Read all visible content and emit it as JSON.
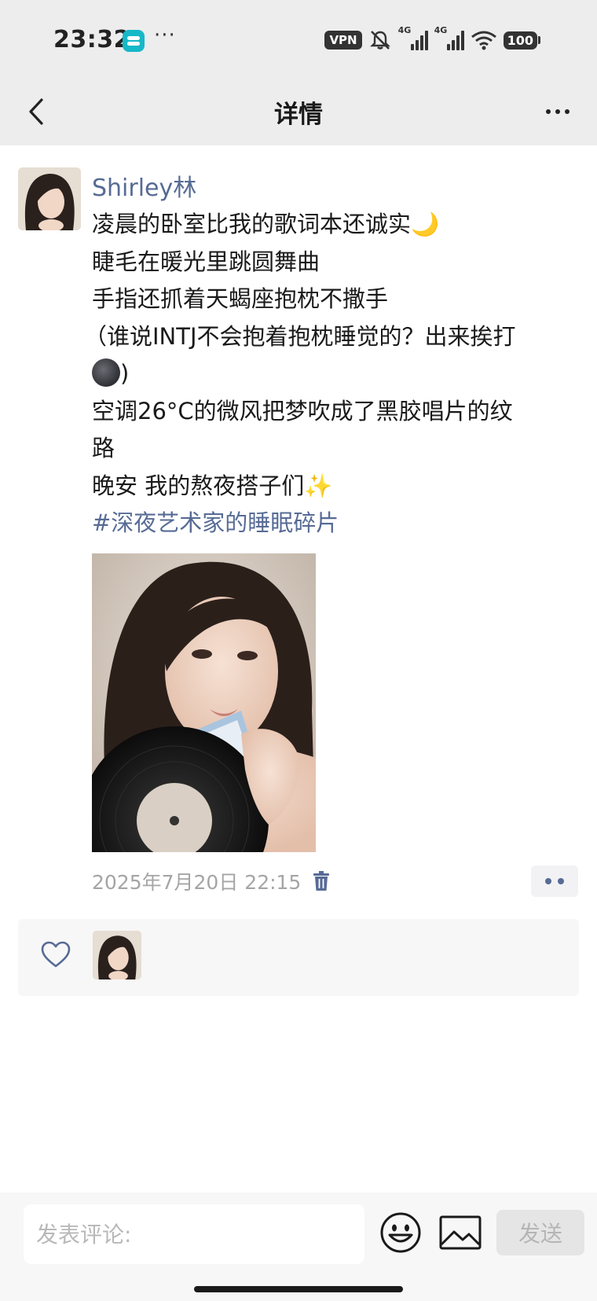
{
  "status_bar": {
    "time": "23:32",
    "dots": "···",
    "vpn": "VPN",
    "network_1": "4G",
    "network_2": "4G",
    "battery": "100"
  },
  "nav": {
    "title": "详情",
    "back_icon": "chevron-left-icon",
    "more_icon": "more-horizontal-icon"
  },
  "post": {
    "author": "Shirley林",
    "lines": [
      "凌晨的卧室比我的歌词本还诚实",
      "睫毛在暖光里跳圆舞曲",
      "手指还抓着天蝎座抱枕不撒手",
      "（谁说INTJ不会抱着抱枕睡觉的？出来挨打",
      ")",
      "空调26°C的微风把梦吹成了黑胶唱片的纹",
      "路",
      "晚安 我的熬夜搭子们",
      "#深夜艺术家的睡眠碎片"
    ],
    "emoji": {
      "moon": "🌙",
      "sparkles": "✨"
    },
    "photo": "portrait-with-vinyl-record",
    "timestamp": "2025年7月20日 22:15",
    "delete_icon": "trash-icon",
    "action_icon": "two-dots-icon"
  },
  "likes": {
    "heart_icon": "heart-outline-icon"
  },
  "comment_bar": {
    "placeholder": "发表评论:",
    "emoji_icon": "smiley-icon",
    "image_icon": "image-icon",
    "send_label": "发送"
  },
  "colors": {
    "link_blue": "#576b95",
    "top_band": "#ededed",
    "timestamp_gray": "#a5a5a5"
  }
}
